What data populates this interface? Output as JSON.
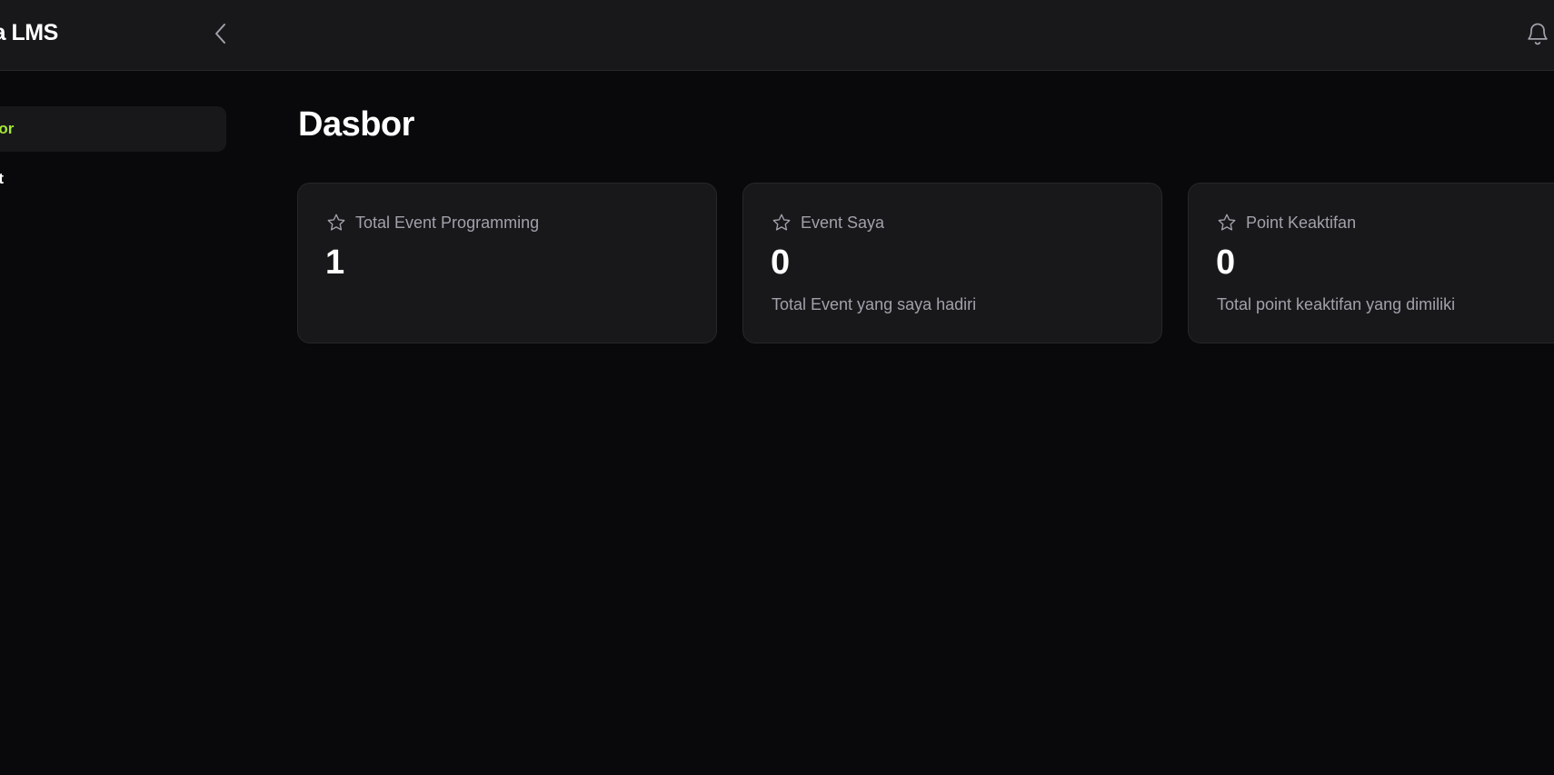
{
  "header": {
    "brand": "edia LMS",
    "collapse_icon": "chevron-left-icon",
    "notification_icon": "bell-icon"
  },
  "sidebar": {
    "items": [
      {
        "label": "bor",
        "active": true
      },
      {
        "label": "nt",
        "active": false
      }
    ],
    "active_color": "#a3e635"
  },
  "main": {
    "title": "Dasbor",
    "cards": [
      {
        "icon": "star-icon",
        "title": "Total Event Programming",
        "value": "1",
        "description": ""
      },
      {
        "icon": "star-icon",
        "title": "Event Saya",
        "value": "0",
        "description": "Total Event yang saya hadiri"
      },
      {
        "icon": "star-icon",
        "title": "Point Keaktifan",
        "value": "0",
        "description": "Total point keaktifan yang dimiliki"
      }
    ]
  }
}
